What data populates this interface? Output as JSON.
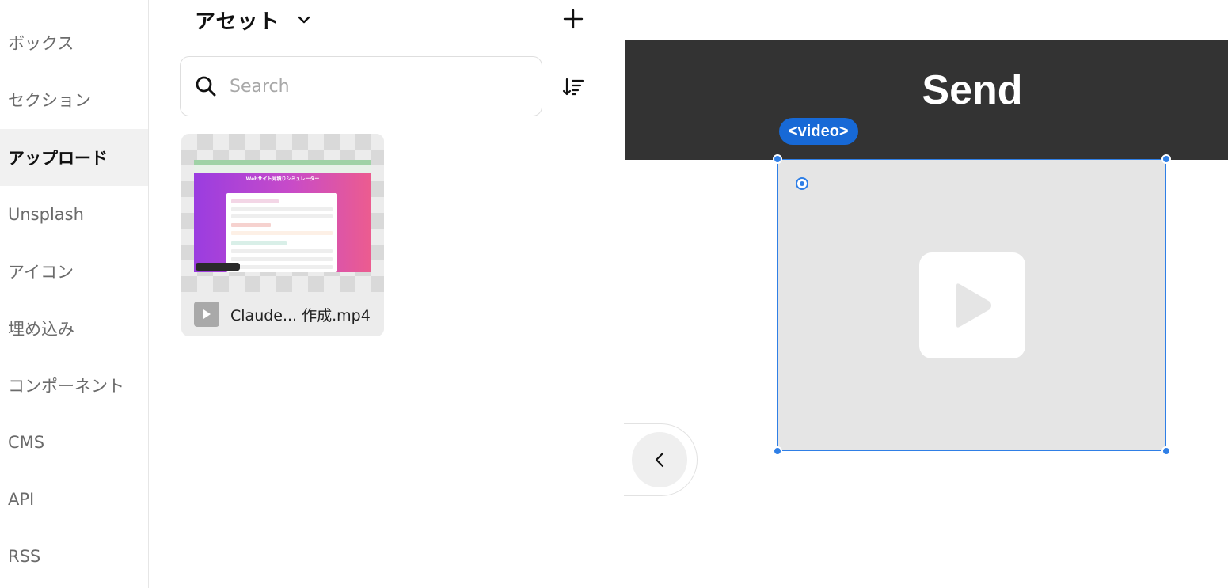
{
  "nav": {
    "items": [
      {
        "label": "ボックス",
        "active": false
      },
      {
        "label": "セクション",
        "active": false
      },
      {
        "label": "アップロード",
        "active": true
      },
      {
        "label": "Unsplash",
        "active": false
      },
      {
        "label": "アイコン",
        "active": false
      },
      {
        "label": "埋め込み",
        "active": false
      },
      {
        "label": "コンポーネント",
        "active": false
      },
      {
        "label": "CMS",
        "active": false
      },
      {
        "label": "API",
        "active": false
      },
      {
        "label": "RSS",
        "active": false
      }
    ]
  },
  "assets": {
    "title": "アセット",
    "search_placeholder": "Search",
    "files": [
      {
        "name": "Claude... 作成.mp4",
        "thumbnail_title": "Webサイト見積りシミュレーター"
      }
    ]
  },
  "canvas": {
    "header_text": "Send",
    "selected_tag": "<video>"
  },
  "colors": {
    "selection_blue": "#2f7fe6",
    "tag_blue": "#1769d6",
    "header_bg": "#333333",
    "video_placeholder_bg": "#e5e5e5"
  }
}
